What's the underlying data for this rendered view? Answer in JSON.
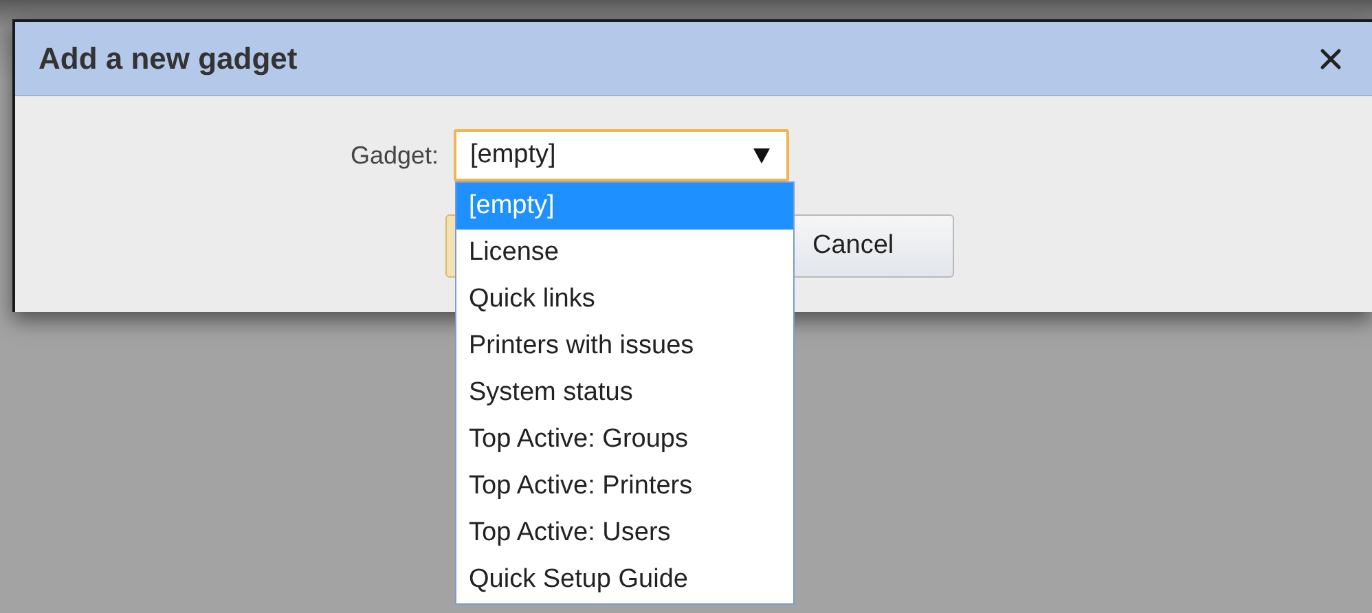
{
  "dialog": {
    "title": "Add a new gadget"
  },
  "form": {
    "label": "Gadget:",
    "select": {
      "value": "[empty]",
      "expanded": true,
      "options": [
        {
          "label": "[empty]",
          "selected": true
        },
        {
          "label": "License",
          "selected": false
        },
        {
          "label": "Quick links",
          "selected": false
        },
        {
          "label": "Printers with issues",
          "selected": false
        },
        {
          "label": "System status",
          "selected": false
        },
        {
          "label": "Top Active: Groups",
          "selected": false
        },
        {
          "label": "Top Active: Printers",
          "selected": false
        },
        {
          "label": "Top Active: Users",
          "selected": false
        },
        {
          "label": "Quick Setup Guide",
          "selected": false
        }
      ]
    }
  },
  "buttons": [
    {
      "label": "Cancel"
    }
  ]
}
